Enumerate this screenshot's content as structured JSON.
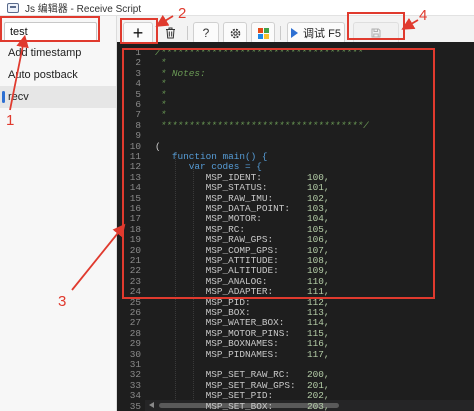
{
  "window": {
    "title": "Js 编辑器 - Receive Script"
  },
  "sidebar": {
    "search": {
      "value": "test",
      "placeholder": ""
    },
    "items": [
      {
        "label": "Add timestamp"
      },
      {
        "label": "Auto postback"
      },
      {
        "label": "recv"
      }
    ]
  },
  "toolbar": {
    "add_icon": "plus-icon",
    "delete_icon": "trash-icon",
    "help_label": "?",
    "settings_icon": "gear-icon",
    "layout_icon": "tiles-icon",
    "run_label": "调试 F5",
    "save_icon": "save-icon",
    "tile_colors": [
      "#e64a19",
      "#43a047",
      "#1e88e5",
      "#fbc02d"
    ]
  },
  "editor": {
    "lines": [
      {
        "n": "1",
        "text": "/************************************"
      },
      {
        "n": "2",
        "text": " *"
      },
      {
        "n": "3",
        "text": " * Notes:"
      },
      {
        "n": "4",
        "text": " *"
      },
      {
        "n": "5",
        "text": " *"
      },
      {
        "n": "6",
        "text": " *"
      },
      {
        "n": "7",
        "text": " *"
      },
      {
        "n": "8",
        "text": " ************************************/"
      },
      {
        "n": "9",
        "text": ""
      },
      {
        "n": "10",
        "text": "("
      },
      {
        "n": "11",
        "text": "   function main() {"
      },
      {
        "n": "12",
        "text": "      var codes = {"
      },
      {
        "n": "13",
        "text": "         MSP_IDENT:",
        "value": "100,"
      },
      {
        "n": "14",
        "text": "         MSP_STATUS:",
        "value": "101,"
      },
      {
        "n": "15",
        "text": "         MSP_RAW_IMU:",
        "value": "102,"
      },
      {
        "n": "16",
        "text": "         MSP_DATA_POINT:",
        "value": "103,"
      },
      {
        "n": "17",
        "text": "         MSP_MOTOR:",
        "value": "104,"
      },
      {
        "n": "18",
        "text": "         MSP_RC:",
        "value": "105,"
      },
      {
        "n": "19",
        "text": "         MSP_RAW_GPS:",
        "value": "106,"
      },
      {
        "n": "20",
        "text": "         MSP_COMP_GPS:",
        "value": "107,"
      },
      {
        "n": "21",
        "text": "         MSP_ATTITUDE:",
        "value": "108,"
      },
      {
        "n": "22",
        "text": "         MSP_ALTITUDE:",
        "value": "109,"
      },
      {
        "n": "23",
        "text": "         MSP_ANALOG:",
        "value": "110,"
      },
      {
        "n": "24",
        "text": "         MSP_ADAPTER:",
        "value": "111,"
      },
      {
        "n": "25",
        "text": "         MSP_PID:",
        "value": "112,"
      },
      {
        "n": "26",
        "text": "         MSP_BOX:",
        "value": "113,"
      },
      {
        "n": "27",
        "text": "         MSP_WATER_BOX:",
        "value": "114,"
      },
      {
        "n": "28",
        "text": "         MSP_MOTOR_PINS:",
        "value": "115,"
      },
      {
        "n": "29",
        "text": "         MSP_BOXNAMES:",
        "value": "116,"
      },
      {
        "n": "30",
        "text": "         MSP_PIDNAMES:",
        "value": "117,"
      },
      {
        "n": "31",
        "text": ""
      },
      {
        "n": "32",
        "text": "         MSP_SET_RAW_RC:",
        "value": "200,"
      },
      {
        "n": "33",
        "text": "         MSP_SET_RAW_GPS:",
        "value": "201,"
      },
      {
        "n": "34",
        "text": "         MSP_SET_PID:",
        "value": "202,"
      },
      {
        "n": "35",
        "text": "         MSP_SET_BOX:",
        "value": "203,"
      }
    ]
  },
  "annotations": {
    "labels": [
      "1",
      "2",
      "3",
      "4"
    ],
    "color": "#e03a2e"
  }
}
